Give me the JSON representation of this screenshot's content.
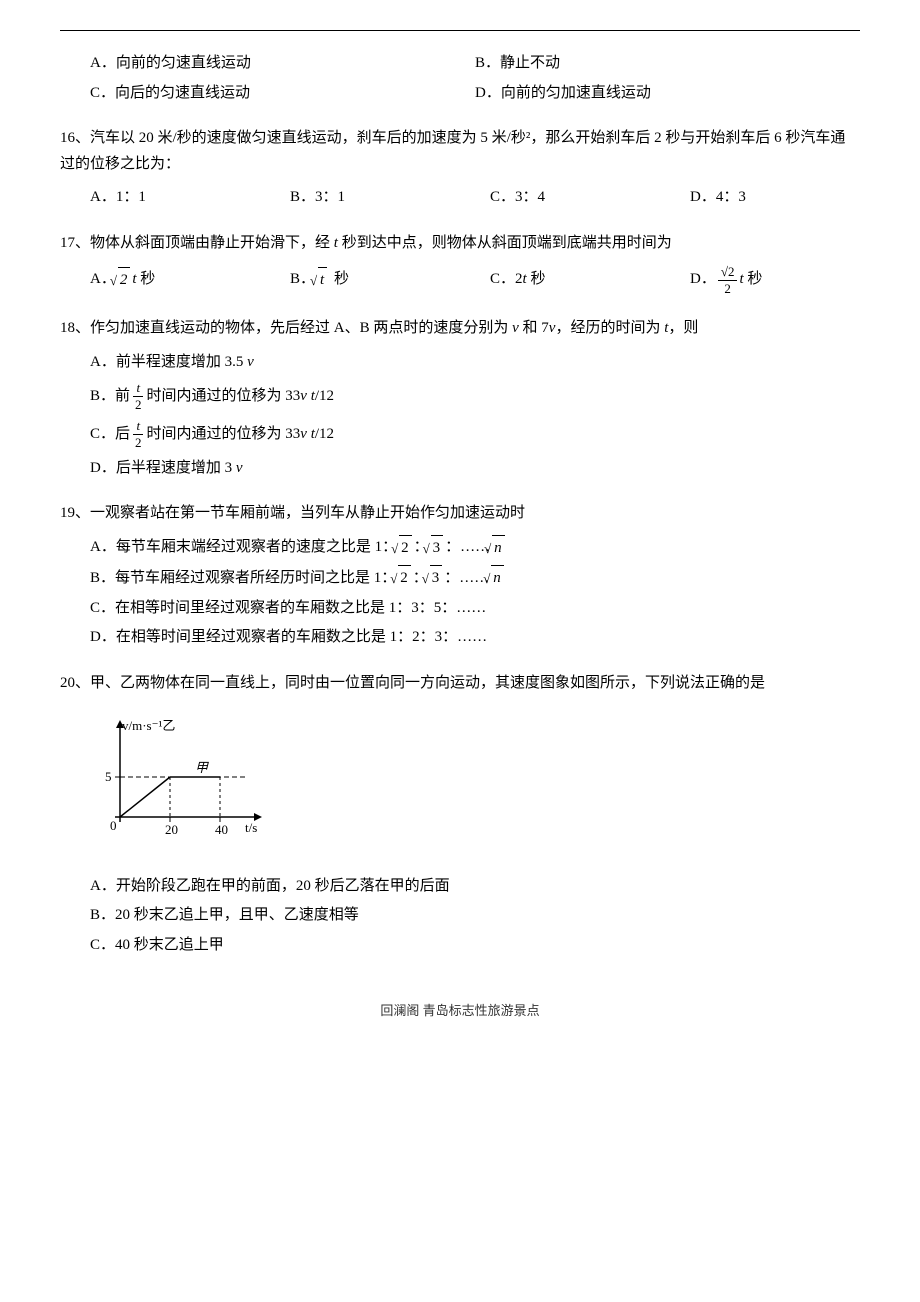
{
  "topline": true,
  "questions": [
    {
      "id": "q15_options",
      "options_row": [
        {
          "label": "A．向前的匀速直线运动",
          "id": "q15a"
        },
        {
          "label": "B．静止不动",
          "id": "q15b"
        }
      ],
      "options_row2": [
        {
          "label": "C．向后的匀速直线运动",
          "id": "q15c"
        },
        {
          "label": "D．向前的匀加速直线运动",
          "id": "q15d"
        }
      ]
    },
    {
      "id": "q16",
      "number": "16",
      "text": "、汽车以 20 米/秒的速度做匀速直线运动，刹车后的加速度为 5 米/秒²，那么开始刹车后 2 秒与开始刹车后 6 秒汽车通过的位移之比为：",
      "options_row": [
        {
          "label": "A．1：1",
          "id": "q16a"
        },
        {
          "label": "B．3：1",
          "id": "q16b"
        },
        {
          "label": "C．3：4",
          "id": "q16c"
        },
        {
          "label": "D．4：3",
          "id": "q16d"
        }
      ]
    },
    {
      "id": "q17",
      "number": "17",
      "text": "、物体从斜面顶端由静止开始滑下，经 t 秒到达中点，则物体从斜面顶端到底端共用时间为",
      "options_row": [
        {
          "label_pre": "A．",
          "sqrt": "2",
          "label_post": "t 秒",
          "id": "q17a"
        },
        {
          "label_pre": "B．",
          "sqrt": "",
          "label_post": "t 秒",
          "id": "q17b"
        },
        {
          "label_pre": "C．",
          "label": "2t 秒",
          "id": "q17c"
        },
        {
          "label_pre": "D．",
          "frac_num": "√2",
          "frac_den": "2",
          "label_post": "t 秒",
          "id": "q17d"
        }
      ]
    },
    {
      "id": "q18",
      "number": "18",
      "text": "、作匀加速直线运动的物体，先后经过 A、B 两点时的速度分别为 v 和 7v，经历的时间为 t，则",
      "options_col": [
        {
          "label": "A．前半程速度增加 3.5 v",
          "id": "q18a"
        },
        {
          "label_pre": "B．前",
          "frac": true,
          "frac_num": "t",
          "frac_den": "2",
          "label_post": "时间内通过的位移为 33v t /12",
          "id": "q18b"
        },
        {
          "label_pre": "C．后",
          "frac": true,
          "frac_num": "t",
          "frac_den": "2",
          "label_post": "时间内通过的位移为 33v t /12",
          "id": "q18c"
        },
        {
          "label": "D．后半程速度增加 3 v",
          "id": "q18d"
        }
      ]
    },
    {
      "id": "q19",
      "number": "19",
      "text": "、一观察者站在第一节车厢前端，当列车从静止开始作匀加速运动时",
      "options_col": [
        {
          "label_html": "A．每节车厢末端经过观察者的速度之比是 1：√2：√3：……√n",
          "id": "q19a"
        },
        {
          "label_html": "B．每节车厢经过观察者所经历时间之比是 1：√2：√3：……√n",
          "id": "q19b"
        },
        {
          "label": "C．在相等时间里经过观察者的车厢数之比是 1：3：5：……",
          "id": "q19c"
        },
        {
          "label": "D．在相等时间里经过观察者的车厢数之比是 1：2：3：……",
          "id": "q19d"
        }
      ]
    },
    {
      "id": "q20",
      "number": "20",
      "text": "、甲、乙两物体在同一直线上，同时由一位置向同一方向运动，其速度图象如图所示，下列说法正确的是",
      "graph": {
        "v_axis_label": "v/m·s⁻¹乙",
        "t_axis_label": "t/s",
        "y_value": 5,
        "x_values": [
          20,
          40
        ],
        "jia_label": "甲",
        "yi_label": "乙"
      },
      "options_col": [
        {
          "label": "A．开始阶段乙跑在甲的前面，20 秒后乙落在甲的后面",
          "id": "q20a"
        },
        {
          "label": "B．20 秒末乙追上甲，且甲、乙速度相等",
          "id": "q20b"
        },
        {
          "label": "C．40 秒末乙追上甲",
          "id": "q20c"
        }
      ]
    }
  ],
  "footer": "回澜阁 青岛标志性旅游景点"
}
